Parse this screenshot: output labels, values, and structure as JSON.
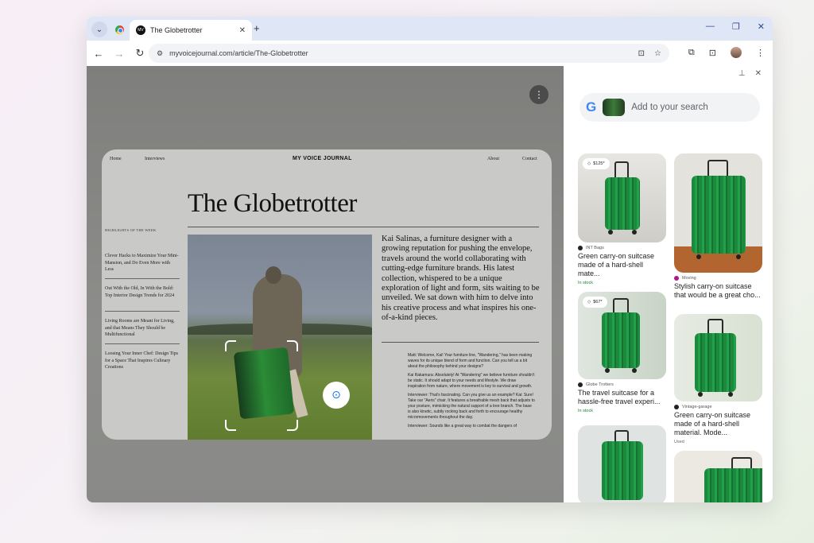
{
  "browser": {
    "tab_title": "The Globetrotter",
    "tab_close": "✕",
    "new_tab": "+",
    "url": "myvoicejournal.com/article/The-Globetrotter"
  },
  "article": {
    "brand": "MY VOICE JOURNAL",
    "nav": [
      "Home",
      "Interviews",
      "About",
      "Contact"
    ],
    "headline": "The Globetrotter",
    "sidebar_title": "HIGHLIGHTS OF THE WEEK",
    "sidebar_items": [
      "Clever Hacks to Maximize Your Mini-Mansion, and Do Even More with Less",
      "Out With the Old, In With the Bold: Top Interior Design Trends for 2024",
      "Living Rooms are Meant for Living, and that Means They Should be Multifunctional",
      "Loosing Your Inner Chef: Design Tips for a Space That Inspires Culinary Creations"
    ],
    "intro": "Kai Salinas, a furniture designer with a growing reputation for pushing the envelope, travels around the world collaborating with cutting-edge furniture brands. His latest collection, whispered to be a unique exploration of light and form, sits waiting to be unveiled. We sat down with him to delve into his creative process and what inspires his one-of-a-kind pieces.",
    "interview": [
      "Matt: Welcome, Kai! Your furniture line, \"Wandering,\" has been making waves for its unique blend of form and function. Can you tell us a bit about the philosophy behind your designs?",
      "Kai Rakamura: Absolutely! At \"Wandering\" we believe furniture shouldn't be static. It should adapt to your needs and lifestyle. We draw inspiration from nature, where movement is key to survival and growth.",
      "Interviewer: That's fascinating. Can you give us an example? Kai: Sure! Take our \"Aeris\" chair. It features a breathable mesh back that adjusts to your posture, mimicking the natural support of a tree branch. The base is also kinetic, subtly rocking back and forth to encourage healthy micromovements throughout the day.",
      "Interviewer: Sounds like a great way to combat the dangers of"
    ]
  },
  "lens_panel": {
    "search_placeholder": "Add to your search",
    "results": [
      {
        "price": "$125*",
        "source": "INT Bags",
        "title": "Green carry-on suitcase made of a hard-shell mate...",
        "stock": "In stock"
      },
      {
        "price": "",
        "source": "Moving",
        "title": "Stylish carry-on suitcase that would be a great cho...",
        "stock": ""
      },
      {
        "price": "$67*",
        "source": "Globe Trotters",
        "title": "The travel suitcase for a hassle-free travel experi...",
        "stock": "In stock"
      },
      {
        "price": "",
        "source": "Vintage-garage",
        "title": "Green carry-on suitcase made of a hard-shell material. Mode...",
        "stock": "Used"
      },
      {
        "price": "",
        "source": "",
        "title": "",
        "stock": ""
      },
      {
        "price": "",
        "source": "",
        "title": "",
        "stock": ""
      }
    ]
  },
  "icons": {
    "tab_search": "chevron-down-icon",
    "back": "←",
    "forward": "→",
    "reload": "↻",
    "lens_menu": "⋮",
    "panel_pin": "⊥",
    "panel_close": "✕"
  },
  "colors": {
    "accent": "#1a73e8",
    "tabstrip": "#dfe7f7",
    "suitcase_green": "#1f9a45",
    "in_stock": "#188038"
  }
}
